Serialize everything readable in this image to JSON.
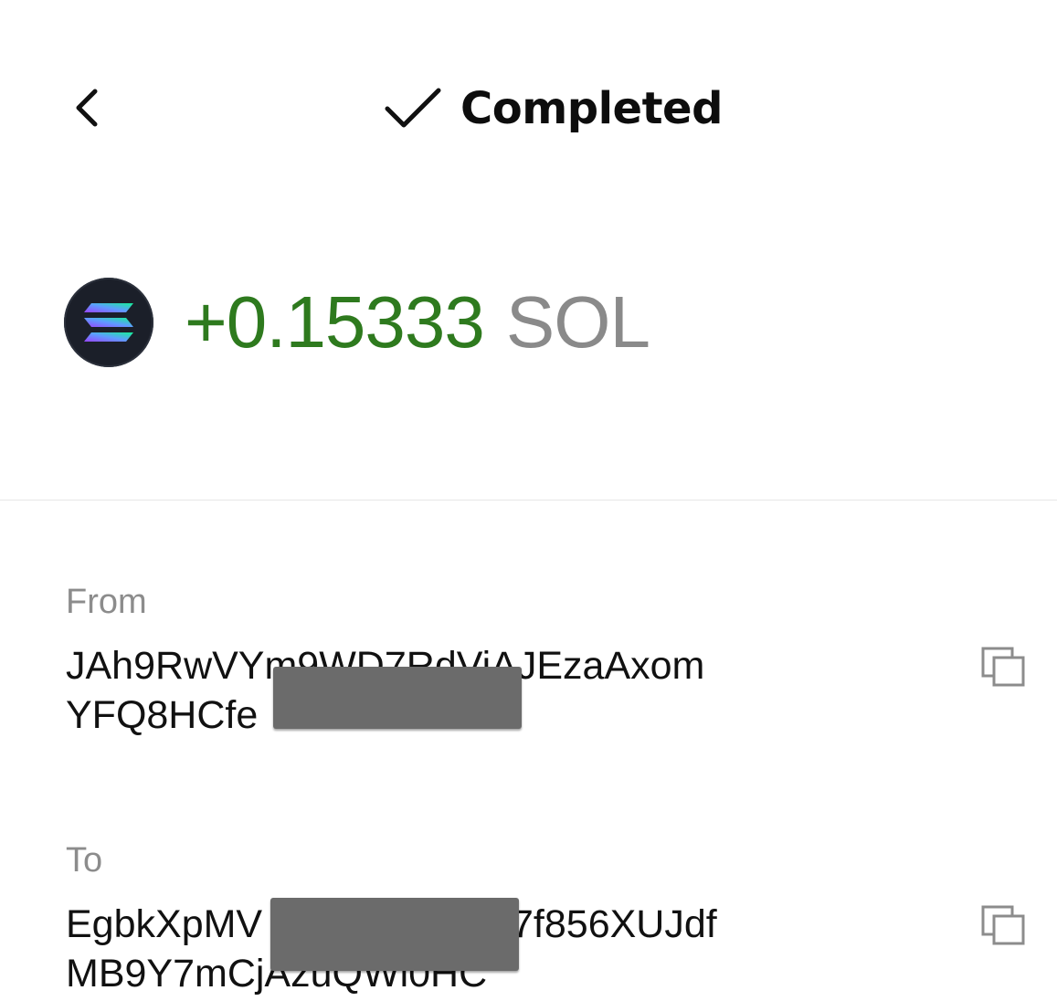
{
  "header": {
    "back_icon": "chevron-left-icon",
    "status_icon": "checkmark-icon",
    "status_label": "Completed"
  },
  "transaction": {
    "token_icon": "solana-logo-icon",
    "amount": "+0.15333",
    "symbol": "SOL",
    "amount_color": "#2e7a1e",
    "symbol_color": "#8a8a8a"
  },
  "from": {
    "label": "From",
    "address_line1": "JAh9RwVYm9WD7RdViAJEzaAxom",
    "address_line2": "YFQ8HCfe",
    "copy_icon": "copy-icon"
  },
  "to": {
    "label": "To",
    "address_line1": "EgbkXpMV",
    "address_line1_tail": "7f856XUJdf",
    "address_line2": "MB9Y7mCjAzuQWi0HC",
    "copy_icon": "copy-icon"
  }
}
